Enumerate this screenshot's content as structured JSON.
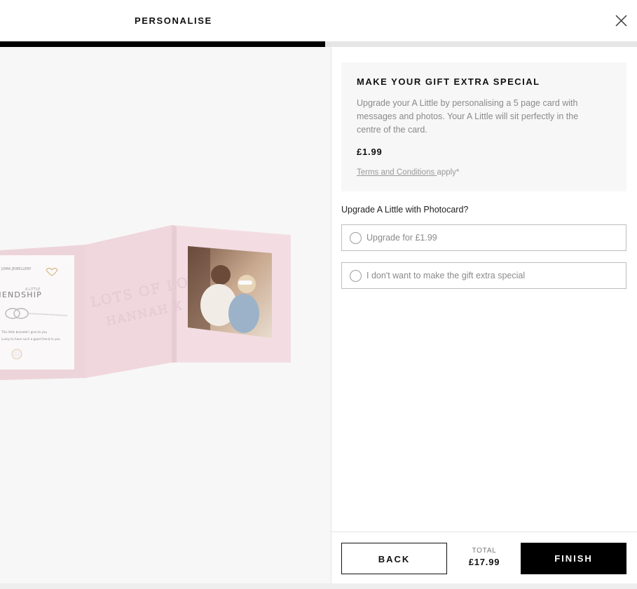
{
  "header": {
    "title": "PERSONALISE",
    "close_icon": "close-icon"
  },
  "progress": {
    "fraction": 0.51,
    "fill_color": "#000000",
    "track_color": "#e6e6e6"
  },
  "preview": {
    "card_color": "#f2dde3",
    "card_text_line1": "LOTS OF LOVE",
    "card_text_line2": "HANNAH X",
    "bracelet_card": {
      "brand": "JOMA JEWELLERY",
      "small_label": "A LITTLE",
      "name": "FRIENDSHIP",
      "line1": "This little bracelet I give to you",
      "line2": "Lucky to have such a good friend in you"
    },
    "photo_alt": "photo-of-two-friends"
  },
  "info": {
    "heading": "MAKE YOUR GIFT EXTRA SPECIAL",
    "description": "Upgrade your A Little by personalising a 5 page card with messages and photos. Your A Little will sit perfectly in the centre of the card.",
    "price": "£1.99",
    "terms_link": "Terms and Conditions ",
    "terms_suffix": " apply*"
  },
  "question": "Upgrade A Little with Photocard?",
  "options": [
    {
      "label": "Upgrade for £1.99",
      "selected": false
    },
    {
      "label": "I don't want to make the gift extra special",
      "selected": false
    }
  ],
  "footer": {
    "back_label": "BACK",
    "total_label": "TOTAL",
    "total_value": "£17.99",
    "finish_label": "FINISH"
  }
}
